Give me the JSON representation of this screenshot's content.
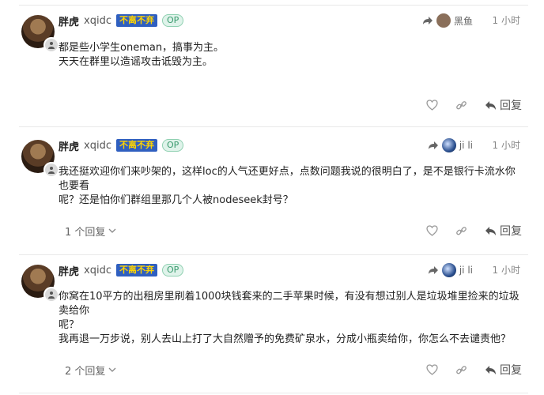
{
  "posts": [
    {
      "author_display": "胖虎",
      "author_username": "xqidc",
      "flair": "不离不弃",
      "op_label": "OP",
      "reply_to": {
        "name": "黑鱼",
        "avatar_color": "#8a6f5a"
      },
      "time": "1 小时",
      "lines": [
        "都是些小学生oneman，搞事为主。",
        "天天在群里以造谣攻击诋毁为主。"
      ],
      "replies_count": "",
      "reply_label": "回复"
    },
    {
      "author_display": "胖虎",
      "author_username": "xqidc",
      "flair": "不离不弃",
      "op_label": "OP",
      "reply_to": {
        "name": "ji li",
        "avatar_color": "#2a4f8f"
      },
      "time": "1 小时",
      "lines": [
        "我还挺欢迎你们来吵架的，这样loc的人气还更好点，点数问题我说的很明白了，是不是银行卡流水你也要看",
        "呢？还是怕你们群组里那几个人被nodeseek封号？"
      ],
      "replies_count": "1 个回复",
      "reply_label": "回复"
    },
    {
      "author_display": "胖虎",
      "author_username": "xqidc",
      "flair": "不离不弃",
      "op_label": "OP",
      "reply_to": {
        "name": "ji li",
        "avatar_color": "#2a4f8f"
      },
      "time": "1 小时",
      "lines": [
        "你窝在10平方的出租房里刷着1000块钱套来的二手苹果时候，有没有想过别人是垃圾堆里捡来的垃圾卖给你",
        "呢？",
        "我再退一万步说，别人去山上打了大自然赠予的免费矿泉水，分成小瓶卖给你，你怎么不去谴责他？"
      ],
      "replies_count": "2 个回复",
      "reply_label": "回复"
    }
  ],
  "colors": {
    "flair_bg": "#2f5fc0",
    "flair_text": "#ffd400",
    "op_text": "#3a9a6e",
    "op_bg": "#dff3ea"
  }
}
